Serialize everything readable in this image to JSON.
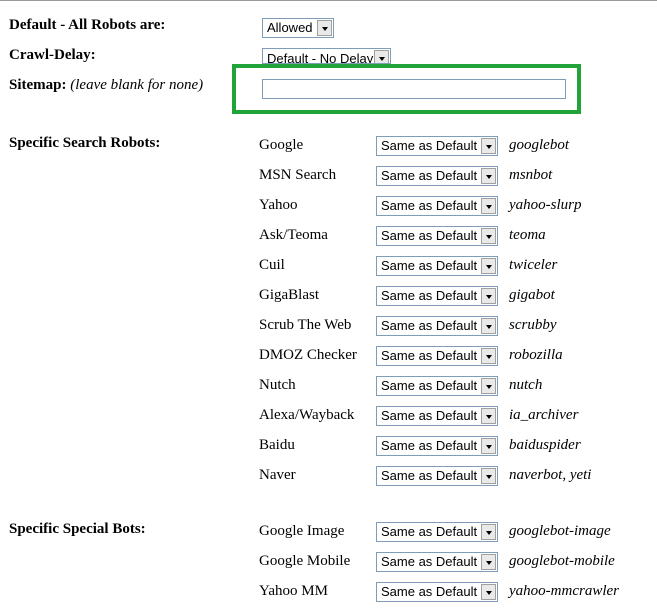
{
  "settings": {
    "default_label": "Default -  All Robots are:",
    "default_value": "Allowed",
    "crawl_delay_label": "Crawl-Delay:",
    "crawl_delay_value": "Default - No Delay",
    "sitemap_label": "Sitemap:",
    "sitemap_hint": "(leave blank for none)",
    "sitemap_value": ""
  },
  "search_robots": {
    "label": "Specific Search Robots:",
    "rows": [
      {
        "name": "Google",
        "value": "Same as Default",
        "agent": "googlebot"
      },
      {
        "name": "MSN Search",
        "value": "Same as Default",
        "agent": "msnbot"
      },
      {
        "name": "Yahoo",
        "value": "Same as Default",
        "agent": "yahoo-slurp"
      },
      {
        "name": "Ask/Teoma",
        "value": "Same as Default",
        "agent": "teoma"
      },
      {
        "name": "Cuil",
        "value": "Same as Default",
        "agent": "twiceler"
      },
      {
        "name": "GigaBlast",
        "value": "Same as Default",
        "agent": "gigabot"
      },
      {
        "name": "Scrub The Web",
        "value": "Same as Default",
        "agent": "scrubby"
      },
      {
        "name": "DMOZ Checker",
        "value": "Same as Default",
        "agent": "robozilla"
      },
      {
        "name": "Nutch",
        "value": "Same as Default",
        "agent": "nutch"
      },
      {
        "name": "Alexa/Wayback",
        "value": "Same as Default",
        "agent": "ia_archiver"
      },
      {
        "name": "Baidu",
        "value": "Same as Default",
        "agent": "baiduspider"
      },
      {
        "name": "Naver",
        "value": "Same as Default",
        "agent": "naverbot, yeti"
      }
    ]
  },
  "special_bots": {
    "label": "Specific Special Bots:",
    "rows": [
      {
        "name": "Google Image",
        "value": "Same as Default",
        "agent": "googlebot-image"
      },
      {
        "name": "Google Mobile",
        "value": "Same as Default",
        "agent": "googlebot-mobile"
      },
      {
        "name": "Yahoo MM",
        "value": "Same as Default",
        "agent": "yahoo-mmcrawler"
      }
    ]
  },
  "colors": {
    "highlight": "#21a33a",
    "field_border": "#7f9db9"
  }
}
